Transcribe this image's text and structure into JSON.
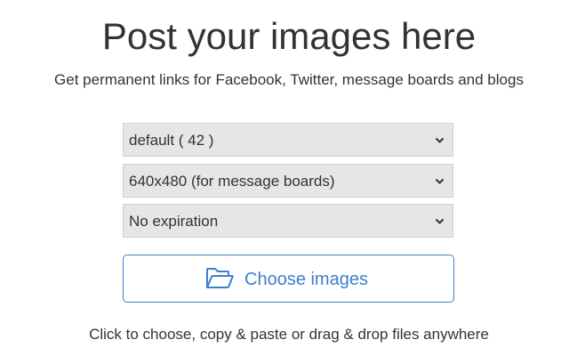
{
  "header": {
    "title": "Post your images here",
    "subtitle": "Get permanent links for Facebook, Twitter, message boards and blogs"
  },
  "form": {
    "album_select": {
      "value": "default ( 42 )",
      "icon": "chevron-down-icon"
    },
    "size_select": {
      "value": "640x480 (for message boards)",
      "icon": "chevron-down-icon"
    },
    "expiration_select": {
      "value": "No expiration",
      "icon": "chevron-down-icon"
    },
    "choose_button": {
      "label": "Choose images",
      "icon": "folder-open-icon"
    },
    "hint": "Click to choose, copy & paste or drag & drop files anywhere"
  },
  "colors": {
    "accent": "#3d7fcc",
    "select_bg": "#e6e6e6",
    "text": "#333333"
  }
}
